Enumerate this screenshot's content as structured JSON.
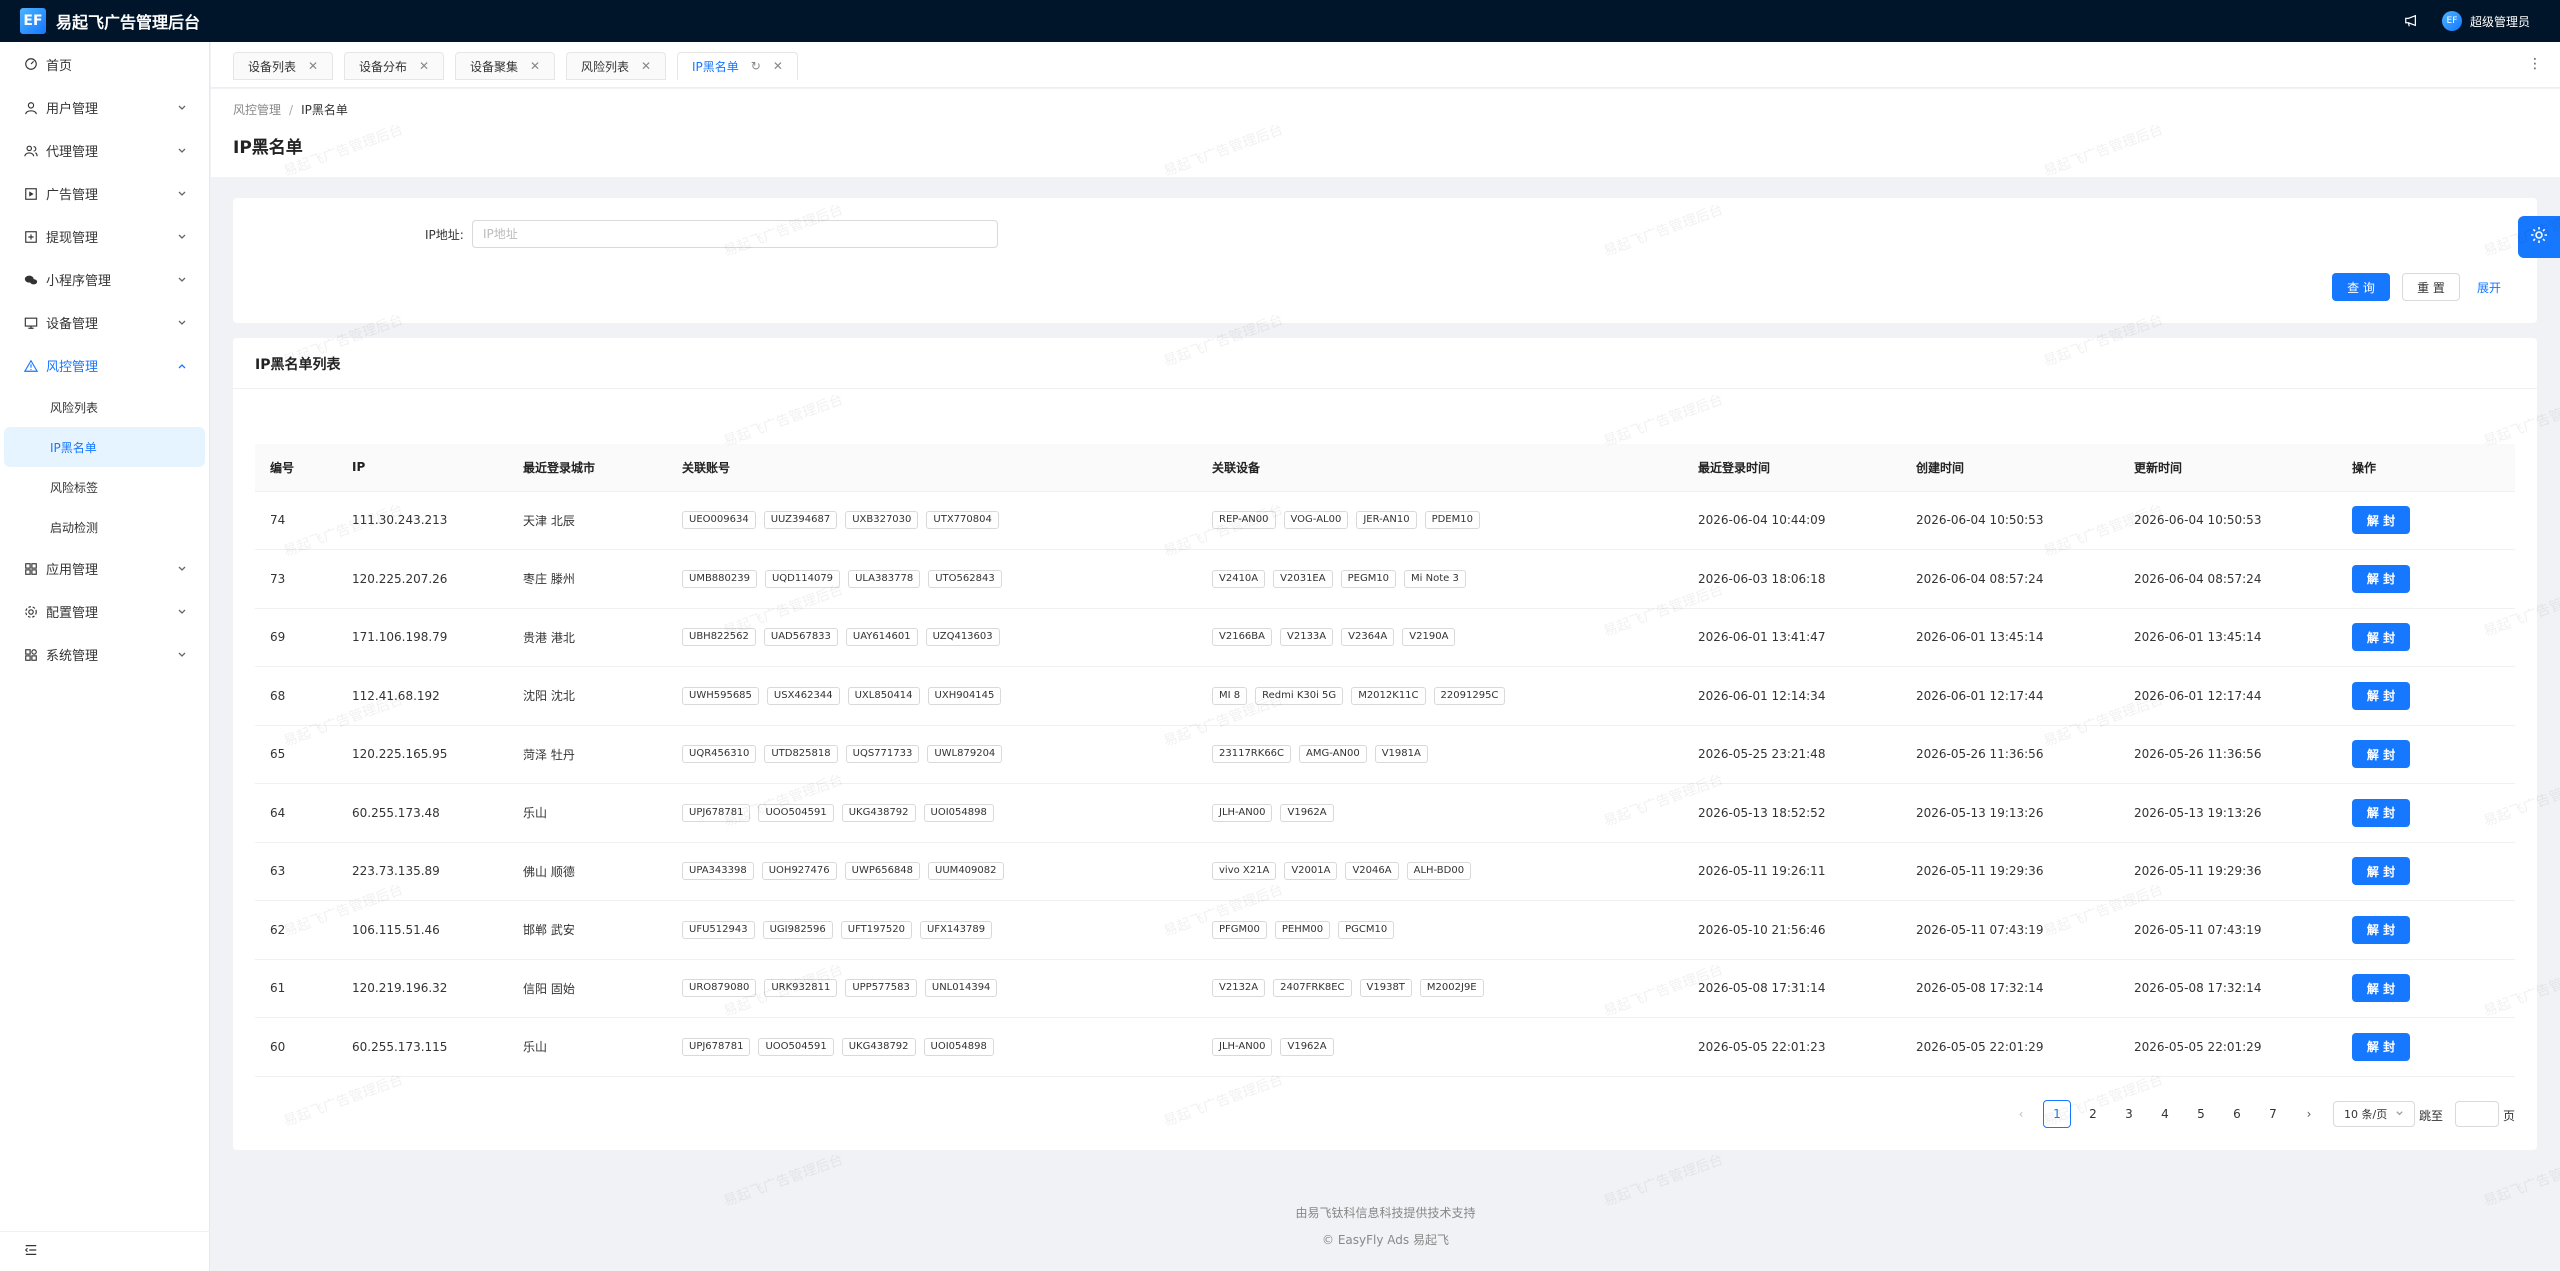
{
  "app": {
    "logo_mark": "EF",
    "title": "易起飞广告管理后台",
    "avatar_text": "EF",
    "user": "超级管理员"
  },
  "sidebar": {
    "items": [
      {
        "label": "首页"
      },
      {
        "label": "用户管理"
      },
      {
        "label": "代理管理"
      },
      {
        "label": "广告管理"
      },
      {
        "label": "提现管理"
      },
      {
        "label": "小程序管理"
      },
      {
        "label": "设备管理"
      },
      {
        "label": "风控管理"
      },
      {
        "label": "应用管理"
      },
      {
        "label": "配置管理"
      },
      {
        "label": "系统管理"
      }
    ],
    "risk_submenu": [
      {
        "label": "风险列表"
      },
      {
        "label": "IP黑名单"
      },
      {
        "label": "风险标签"
      },
      {
        "label": "启动检测"
      }
    ]
  },
  "tabs": [
    {
      "label": "设备列表"
    },
    {
      "label": "设备分布"
    },
    {
      "label": "设备聚集"
    },
    {
      "label": "风险列表"
    },
    {
      "label": "IP黑名单"
    }
  ],
  "breadcrumb": {
    "parent": "风控管理",
    "current": "IP黑名单"
  },
  "page_title": "IP黑名单",
  "search": {
    "ip_label": "IP地址:",
    "ip_placeholder": "IP地址",
    "query": "查 询",
    "reset": "重 置",
    "expand": "展开"
  },
  "table": {
    "title": "IP黑名单列表",
    "columns": [
      "编号",
      "IP",
      "最近登录城市",
      "关联账号",
      "关联设备",
      "最近登录时间",
      "创建时间",
      "更新时间",
      "操作"
    ],
    "action_label": "解 封",
    "rows": [
      {
        "id": "74",
        "ip": "111.30.243.213",
        "city": "天津 北辰",
        "accounts": [
          "UEO009634",
          "UUZ394687",
          "UXB327030",
          "UTX770804"
        ],
        "devices": [
          "REP-AN00",
          "VOG-AL00",
          "JER-AN10",
          "PDEM10"
        ],
        "last_login": "2026-06-04 10:44:09",
        "created": "2026-06-04 10:50:53",
        "updated": "2026-06-04 10:50:53"
      },
      {
        "id": "73",
        "ip": "120.225.207.26",
        "city": "枣庄 滕州",
        "accounts": [
          "UMB880239",
          "UQD114079",
          "ULA383778",
          "UTO562843"
        ],
        "devices": [
          "V2410A",
          "V2031EA",
          "PEGM10",
          "Mi Note 3"
        ],
        "last_login": "2026-06-03 18:06:18",
        "created": "2026-06-04 08:57:24",
        "updated": "2026-06-04 08:57:24"
      },
      {
        "id": "69",
        "ip": "171.106.198.79",
        "city": "贵港 港北",
        "accounts": [
          "UBH822562",
          "UAD567833",
          "UAY614601",
          "UZQ413603"
        ],
        "devices": [
          "V2166BA",
          "V2133A",
          "V2364A",
          "V2190A"
        ],
        "last_login": "2026-06-01 13:41:47",
        "created": "2026-06-01 13:45:14",
        "updated": "2026-06-01 13:45:14"
      },
      {
        "id": "68",
        "ip": "112.41.68.192",
        "city": "沈阳 沈北",
        "accounts": [
          "UWH595685",
          "USX462344",
          "UXL850414",
          "UXH904145"
        ],
        "devices": [
          "MI 8",
          "Redmi K30i 5G",
          "M2012K11C",
          "22091295C"
        ],
        "last_login": "2026-06-01 12:14:34",
        "created": "2026-06-01 12:17:44",
        "updated": "2026-06-01 12:17:44"
      },
      {
        "id": "65",
        "ip": "120.225.165.95",
        "city": "菏泽 牡丹",
        "accounts": [
          "UQR456310",
          "UTD825818",
          "UQS771733",
          "UWL879204"
        ],
        "devices": [
          "23117RK66C",
          "AMG-AN00",
          "V1981A"
        ],
        "last_login": "2026-05-25 23:21:48",
        "created": "2026-05-26 11:36:56",
        "updated": "2026-05-26 11:36:56"
      },
      {
        "id": "64",
        "ip": "60.255.173.48",
        "city": "乐山",
        "accounts": [
          "UPJ678781",
          "UOO504591",
          "UKG438792",
          "UOI054898"
        ],
        "devices": [
          "JLH-AN00",
          "V1962A"
        ],
        "last_login": "2026-05-13 18:52:52",
        "created": "2026-05-13 19:13:26",
        "updated": "2026-05-13 19:13:26"
      },
      {
        "id": "63",
        "ip": "223.73.135.89",
        "city": "佛山 顺德",
        "accounts": [
          "UPA343398",
          "UOH927476",
          "UWP656848",
          "UUM409082"
        ],
        "devices": [
          "vivo X21A",
          "V2001A",
          "V2046A",
          "ALH-BD00"
        ],
        "last_login": "2026-05-11 19:26:11",
        "created": "2026-05-11 19:29:36",
        "updated": "2026-05-11 19:29:36"
      },
      {
        "id": "62",
        "ip": "106.115.51.46",
        "city": "邯郸 武安",
        "accounts": [
          "UFU512943",
          "UGI982596",
          "UFT197520",
          "UFX143789"
        ],
        "devices": [
          "PFGM00",
          "PEHM00",
          "PGCM10"
        ],
        "last_login": "2026-05-10 21:56:46",
        "created": "2026-05-11 07:43:19",
        "updated": "2026-05-11 07:43:19"
      },
      {
        "id": "61",
        "ip": "120.219.196.32",
        "city": "信阳 固始",
        "accounts": [
          "URO879080",
          "URK932811",
          "UPP577583",
          "UNL014394"
        ],
        "devices": [
          "V2132A",
          "2407FRK8EC",
          "V1938T",
          "M2002J9E"
        ],
        "last_login": "2026-05-08 17:31:14",
        "created": "2026-05-08 17:32:14",
        "updated": "2026-05-08 17:32:14"
      },
      {
        "id": "60",
        "ip": "60.255.173.115",
        "city": "乐山",
        "accounts": [
          "UPJ678781",
          "UOO504591",
          "UKG438792",
          "UOI054898"
        ],
        "devices": [
          "JLH-AN00",
          "V1962A"
        ],
        "last_login": "2026-05-05 22:01:23",
        "created": "2026-05-05 22:01:29",
        "updated": "2026-05-05 22:01:29"
      }
    ]
  },
  "pagination": {
    "prev": "‹",
    "next": "›",
    "pages": [
      "1",
      "2",
      "3",
      "4",
      "5",
      "6",
      "7"
    ],
    "current_page": "1",
    "page_size": "10 条/页",
    "jump_prefix": "跳至",
    "jump_suffix": "页"
  },
  "footer": {
    "line1": "由易飞钛科信息科技提供技术支持",
    "line2": "© EasyFly Ads 易起飞"
  },
  "watermark": "易起飞广告管理后台"
}
